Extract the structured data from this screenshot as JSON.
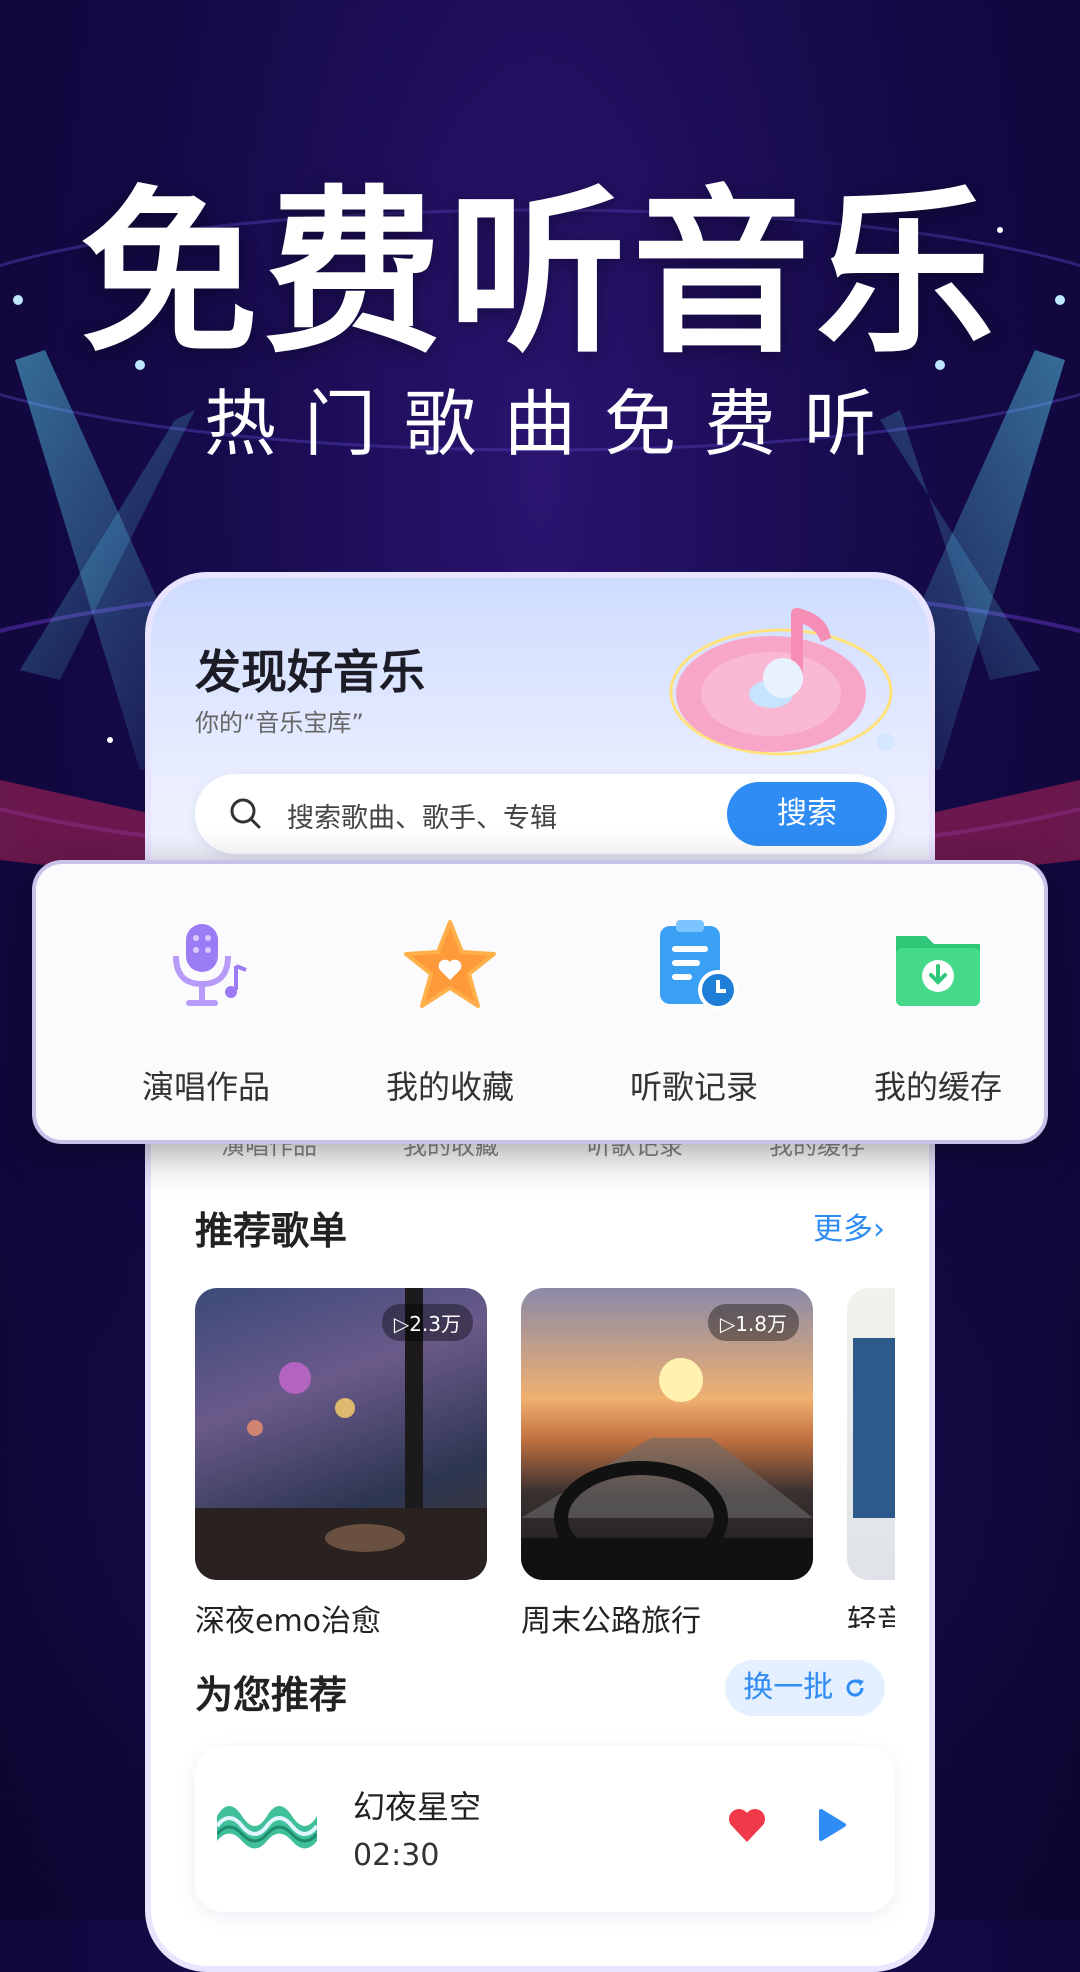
{
  "promo": {
    "headline": "免费听音乐",
    "subheadline": "热门歌曲免费听"
  },
  "phone": {
    "title": "发现好音乐",
    "subtitle": "你的“音乐宝库”",
    "search": {
      "placeholder": "搜索歌曲、歌手、专辑",
      "button_label": "搜索"
    },
    "ghost_labels": [
      "演唱作品",
      "我的收藏",
      "听歌记录",
      "我的缓存"
    ],
    "playlists_section": {
      "title": "推荐歌单",
      "more_label": "更多›",
      "items": [
        {
          "name": "深夜emo治愈",
          "play_count": "▷2.3万"
        },
        {
          "name": "周末公路旅行",
          "play_count": "▷1.8万"
        },
        {
          "name": "轻音"
        }
      ]
    },
    "recommend_section": {
      "title": "为您推荐",
      "refresh_label": "换一批"
    },
    "song": {
      "name": "幻夜星空",
      "duration": "02:30"
    }
  },
  "quick_actions": [
    {
      "label": "演唱作品",
      "icon": "microphone-icon"
    },
    {
      "label": "我的收藏",
      "icon": "star-icon"
    },
    {
      "label": "听歌记录",
      "icon": "history-icon"
    },
    {
      "label": "我的缓存",
      "icon": "download-folder-icon"
    }
  ],
  "colors": {
    "background": "#160a4a",
    "accent": "#2f8cf4",
    "heart": "#f03a4a"
  }
}
